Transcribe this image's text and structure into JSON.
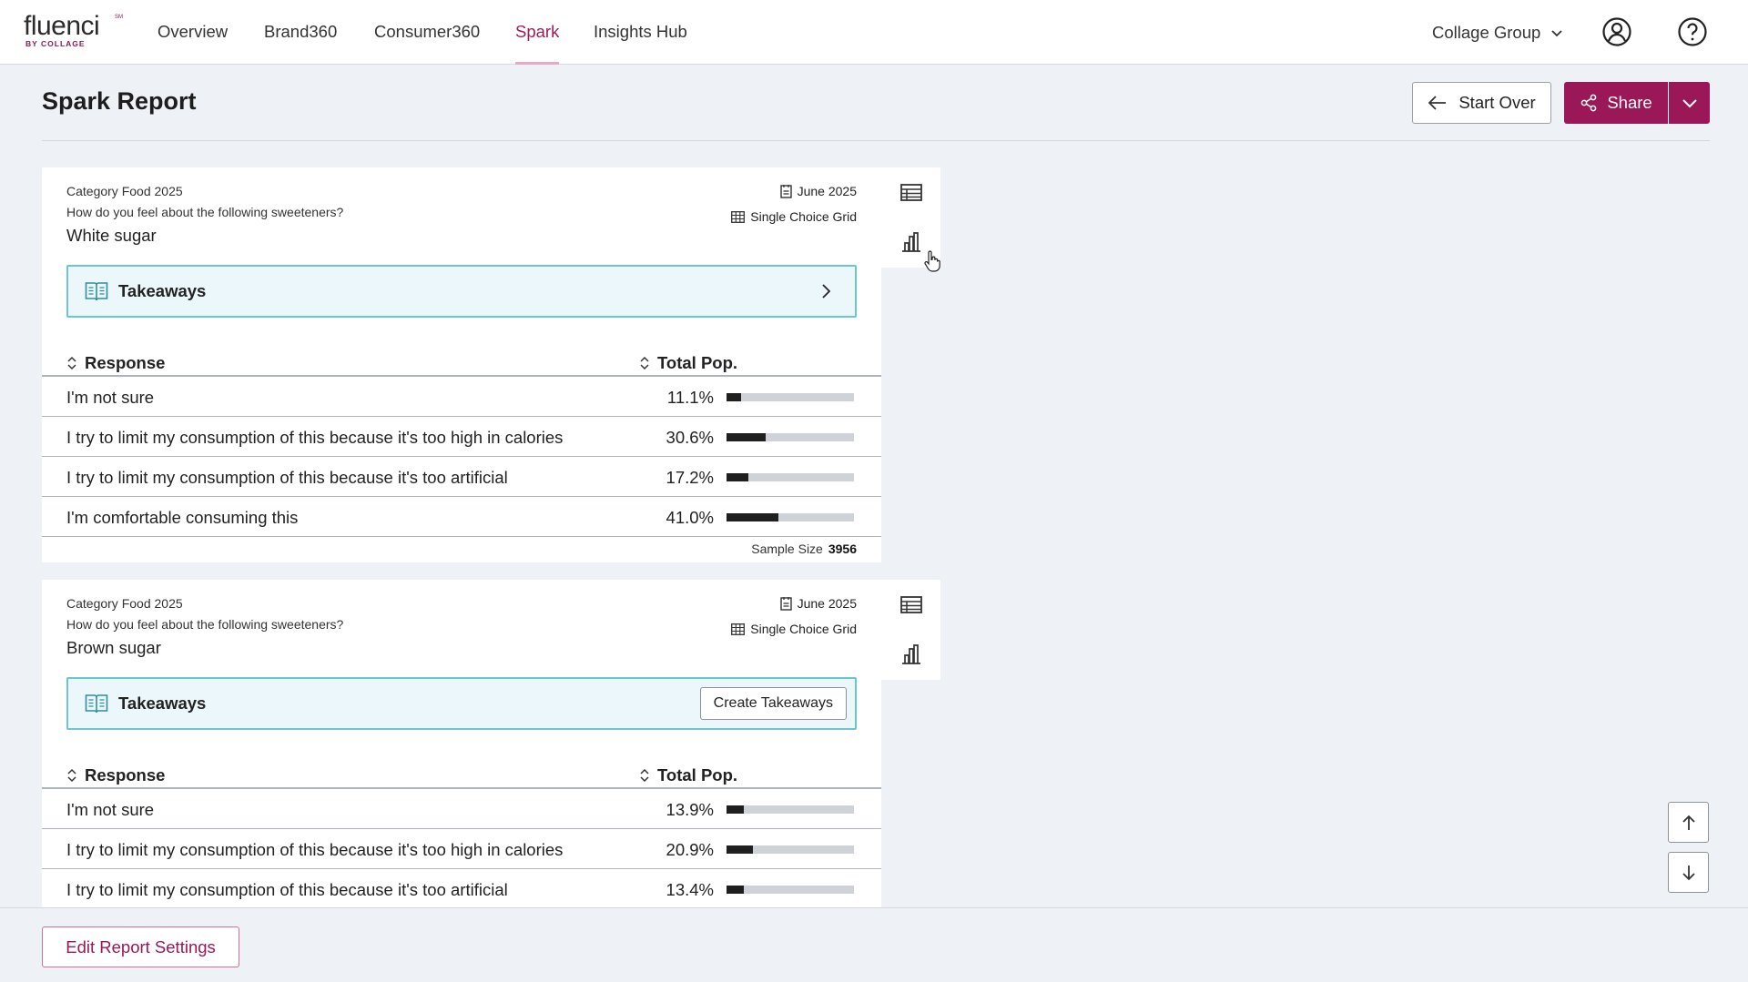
{
  "brand": {
    "wordmark": "fluenci",
    "sm": "SM",
    "sub": "BY COLLAGE"
  },
  "nav": {
    "tabs": [
      {
        "label": "Overview"
      },
      {
        "label": "Brand360"
      },
      {
        "label": "Consumer360"
      },
      {
        "label": "Spark"
      },
      {
        "label": "Insights Hub"
      }
    ],
    "active_tab": "Spark",
    "org_label": "Collage Group"
  },
  "header": {
    "title": "Spark Report",
    "start_over_label": "Start Over",
    "share_label": "Share"
  },
  "cards": [
    {
      "category": "Category Food 2025",
      "question": "How do you feel about the following sweeteners?",
      "item": "White sugar",
      "date": "June 2025",
      "type": "Single Choice Grid",
      "takeaways_label": "Takeaways",
      "col_response": "Response",
      "col_total": "Total Pop.",
      "rows": [
        {
          "label": "I'm not sure",
          "pct_text": "11.1%",
          "pct": 11.1
        },
        {
          "label": "I try to limit my consumption of this because it's too high in calories",
          "pct_text": "30.6%",
          "pct": 30.6
        },
        {
          "label": "I try to limit my consumption of this because it's too artificial",
          "pct_text": "17.2%",
          "pct": 17.2
        },
        {
          "label": "I'm comfortable consuming this",
          "pct_text": "41.0%",
          "pct": 41.0
        }
      ],
      "sample_label": "Sample Size",
      "sample_value": "3956"
    },
    {
      "category": "Category Food 2025",
      "question": "How do you feel about the following sweeteners?",
      "item": "Brown sugar",
      "date": "June 2025",
      "type": "Single Choice Grid",
      "takeaways_label": "Takeaways",
      "create_label": "Create Takeaways",
      "col_response": "Response",
      "col_total": "Total Pop.",
      "rows": [
        {
          "label": "I'm not sure",
          "pct_text": "13.9%",
          "pct": 13.9
        },
        {
          "label": "I try to limit my consumption of this because it's too high in calories",
          "pct_text": "20.9%",
          "pct": 20.9
        },
        {
          "label": "I try to limit my consumption of this because it's too artificial",
          "pct_text": "13.4%",
          "pct": 13.4
        }
      ]
    }
  ],
  "footer": {
    "edit_label": "Edit Report Settings"
  },
  "colors": {
    "brand": "#9b1858",
    "accent_border": "#6cc5cf",
    "takeaway_bg": "#ebf7fb",
    "bar": "#1f1f1f"
  }
}
